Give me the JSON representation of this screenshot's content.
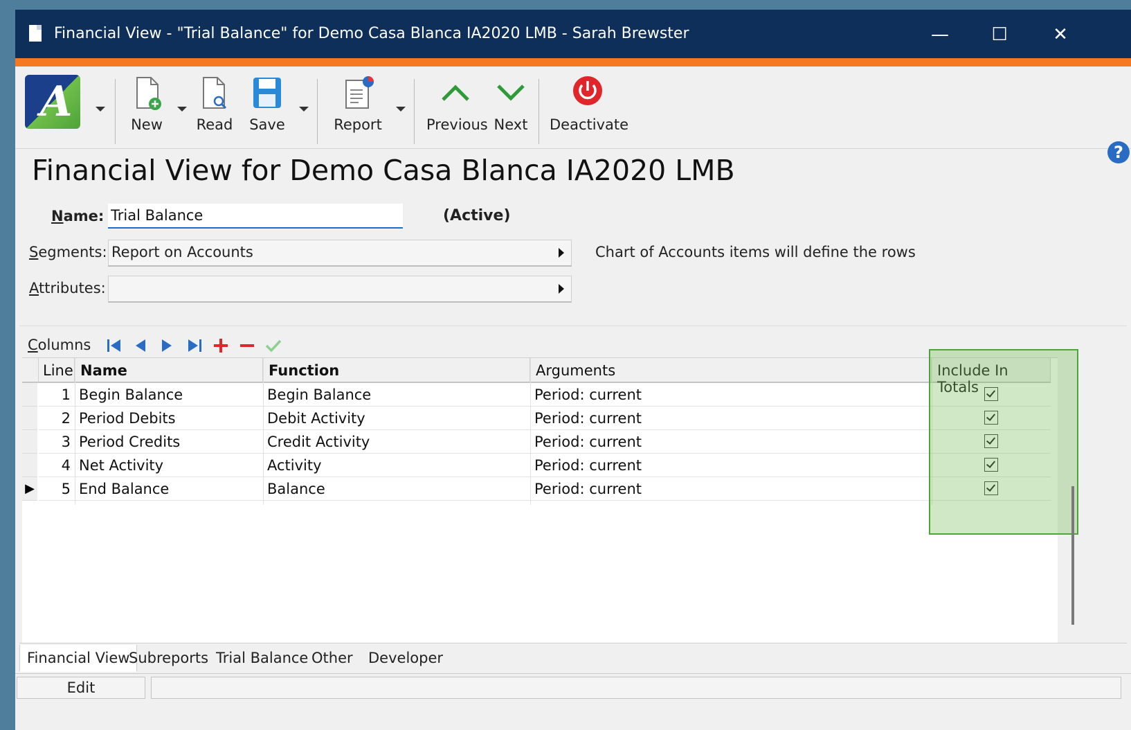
{
  "window": {
    "title": "Financial View - \"Trial Balance\" for Demo Casa Blanca IA2020 LMB - Sarah Brewster",
    "minimize_glyph": "—",
    "maximize_glyph": "☐",
    "close_glyph": "✕"
  },
  "toolbar": {
    "logo_letter": "A",
    "new_label": "New",
    "read_label": "Read",
    "save_label": "Save",
    "report_label": "Report",
    "previous_label": "Previous",
    "next_label": "Next",
    "deactivate_label": "Deactivate"
  },
  "help_glyph": "?",
  "page_title": "Financial View for Demo Casa Blanca IA2020 LMB",
  "form": {
    "name_label_hot": "N",
    "name_label_rest": "ame:",
    "name_value": "Trial Balance",
    "status": "(Active)",
    "segments_label_hot": "S",
    "segments_label_rest": "egments:",
    "segments_value": "Report on Accounts",
    "segments_description": "Chart of Accounts items will define the rows",
    "attributes_label_hot": "A",
    "attributes_label_rest": "ttributes:",
    "attributes_value": ""
  },
  "columns_toolbar": {
    "label_hot": "C",
    "label_rest": "olumns"
  },
  "grid": {
    "headers": {
      "line": "Line",
      "name": "Name",
      "function": "Function",
      "arguments": "Arguments",
      "include_in_totals": "Include In Totals"
    },
    "rows": [
      {
        "line": "1",
        "name": "Begin Balance",
        "function": "Begin Balance",
        "arguments": "Period: current",
        "include": true
      },
      {
        "line": "2",
        "name": "Period Debits",
        "function": "Debit Activity",
        "arguments": "Period: current",
        "include": true
      },
      {
        "line": "3",
        "name": "Period Credits",
        "function": "Credit Activity",
        "arguments": "Period: current",
        "include": true
      },
      {
        "line": "4",
        "name": "Net Activity",
        "function": "Activity",
        "arguments": "Period: current",
        "include": true
      },
      {
        "line": "5",
        "name": "End Balance",
        "function": "Balance",
        "arguments": "Period: current",
        "include": true
      }
    ],
    "current_row_indicator": "▶"
  },
  "tabs": [
    "Financial View",
    "Subreports",
    "Trial Balance",
    "Other",
    "Developer"
  ],
  "statusbar": {
    "mode": "Edit"
  },
  "colors": {
    "titlebar": "#0e2f5a",
    "accent": "#f47920",
    "highlight": "#4ea33a"
  }
}
